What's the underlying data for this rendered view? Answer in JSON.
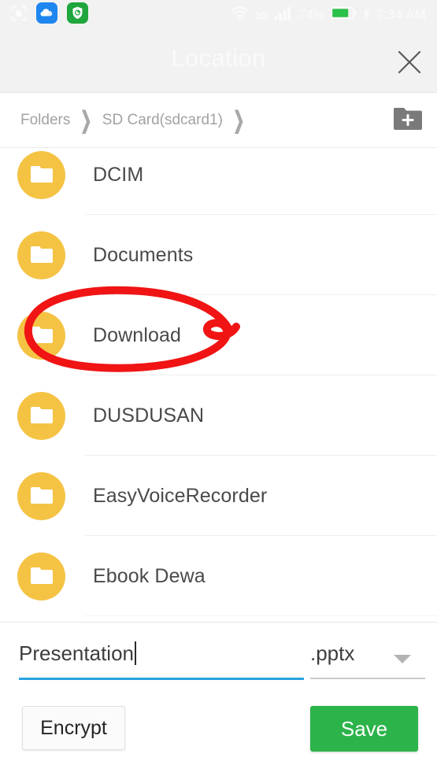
{
  "status_bar": {
    "icons_left": [
      "screenshot-capture-icon",
      "cloud-app-icon",
      "security-shield-app-icon"
    ],
    "wifi_icon": "wifi-icon",
    "network_type": "3G",
    "signal_icon": "signal-bars-icon",
    "battery_percent": "74%",
    "battery_icon": "battery-charging-icon",
    "time": "7:34 AM",
    "background_color": "#f2f2f2"
  },
  "title_bar": {
    "title": "Location",
    "close_icon": "close-icon",
    "title_color": "#fafafa",
    "background_color": "#f2f2f2"
  },
  "breadcrumb": {
    "items": [
      {
        "label": "Folders"
      },
      {
        "label": "SD Card(sdcard1)"
      }
    ],
    "separator": "❯",
    "new_folder_icon": "new-folder-icon"
  },
  "file_list": {
    "rows": [
      {
        "name": "DCIM",
        "icon": "folder-icon"
      },
      {
        "name": "Documents",
        "icon": "folder-icon"
      },
      {
        "name": "Download",
        "icon": "folder-icon",
        "annotated": true
      },
      {
        "name": "DUSDUSAN",
        "icon": "folder-icon"
      },
      {
        "name": "EasyVoiceRecorder",
        "icon": "folder-icon"
      },
      {
        "name": "Ebook Dewa",
        "icon": "folder-icon"
      }
    ],
    "folder_badge_color": "#f5c344"
  },
  "annotation": {
    "type": "hand-drawn-ellipse",
    "target": "Download",
    "color": "#f01414",
    "stroke_width": 10
  },
  "save_panel": {
    "filename_value": "Presentation",
    "filename_placeholder": "File name",
    "filename_underline_color": "#29a2e0",
    "extension_value": ".pptx",
    "extension_caret_icon": "chevron-down-icon",
    "encrypt_label": "Encrypt",
    "save_label": "Save",
    "save_color": "#2cb34a"
  }
}
